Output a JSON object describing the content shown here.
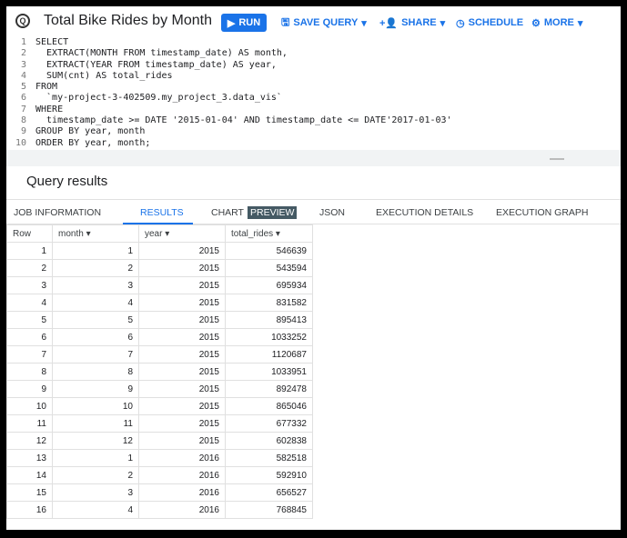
{
  "header": {
    "title": "Total Bike Rides by Month",
    "run": "RUN",
    "save": "SAVE QUERY",
    "share": "SHARE",
    "schedule": "SCHEDULE",
    "more": "MORE",
    "accent": "#1a73e8"
  },
  "code": [
    "SELECT",
    "  EXTRACT(MONTH FROM timestamp_date) AS month,",
    "  EXTRACT(YEAR FROM timestamp_date) AS year,",
    "  SUM(cnt) AS total_rides",
    "FROM",
    "  `my-project-3-402509.my_project_3.data_vis`",
    "WHERE",
    "  timestamp_date >= DATE '2015-01-04' AND timestamp_date <= DATE'2017-01-03'",
    "GROUP BY year, month",
    "ORDER BY year, month;"
  ],
  "results": {
    "title": "Query results",
    "tabs": [
      "JOB INFORMATION",
      "RESULTS",
      "CHART",
      "JSON",
      "EXECUTION DETAILS",
      "EXECUTION GRAPH"
    ],
    "preview_badge": "PREVIEW",
    "active_tab": "RESULTS",
    "columns": [
      "Row",
      "month",
      "year",
      "total_rides"
    ],
    "rows": [
      [
        1,
        1,
        2015,
        546639
      ],
      [
        2,
        2,
        2015,
        543594
      ],
      [
        3,
        3,
        2015,
        695934
      ],
      [
        4,
        4,
        2015,
        831582
      ],
      [
        5,
        5,
        2015,
        895413
      ],
      [
        6,
        6,
        2015,
        1033252
      ],
      [
        7,
        7,
        2015,
        1120687
      ],
      [
        8,
        8,
        2015,
        1033951
      ],
      [
        9,
        9,
        2015,
        892478
      ],
      [
        10,
        10,
        2015,
        865046
      ],
      [
        11,
        11,
        2015,
        677332
      ],
      [
        12,
        12,
        2015,
        602838
      ],
      [
        13,
        1,
        2016,
        582518
      ],
      [
        14,
        2,
        2016,
        592910
      ],
      [
        15,
        3,
        2016,
        656527
      ],
      [
        16,
        4,
        2016,
        768845
      ]
    ]
  }
}
